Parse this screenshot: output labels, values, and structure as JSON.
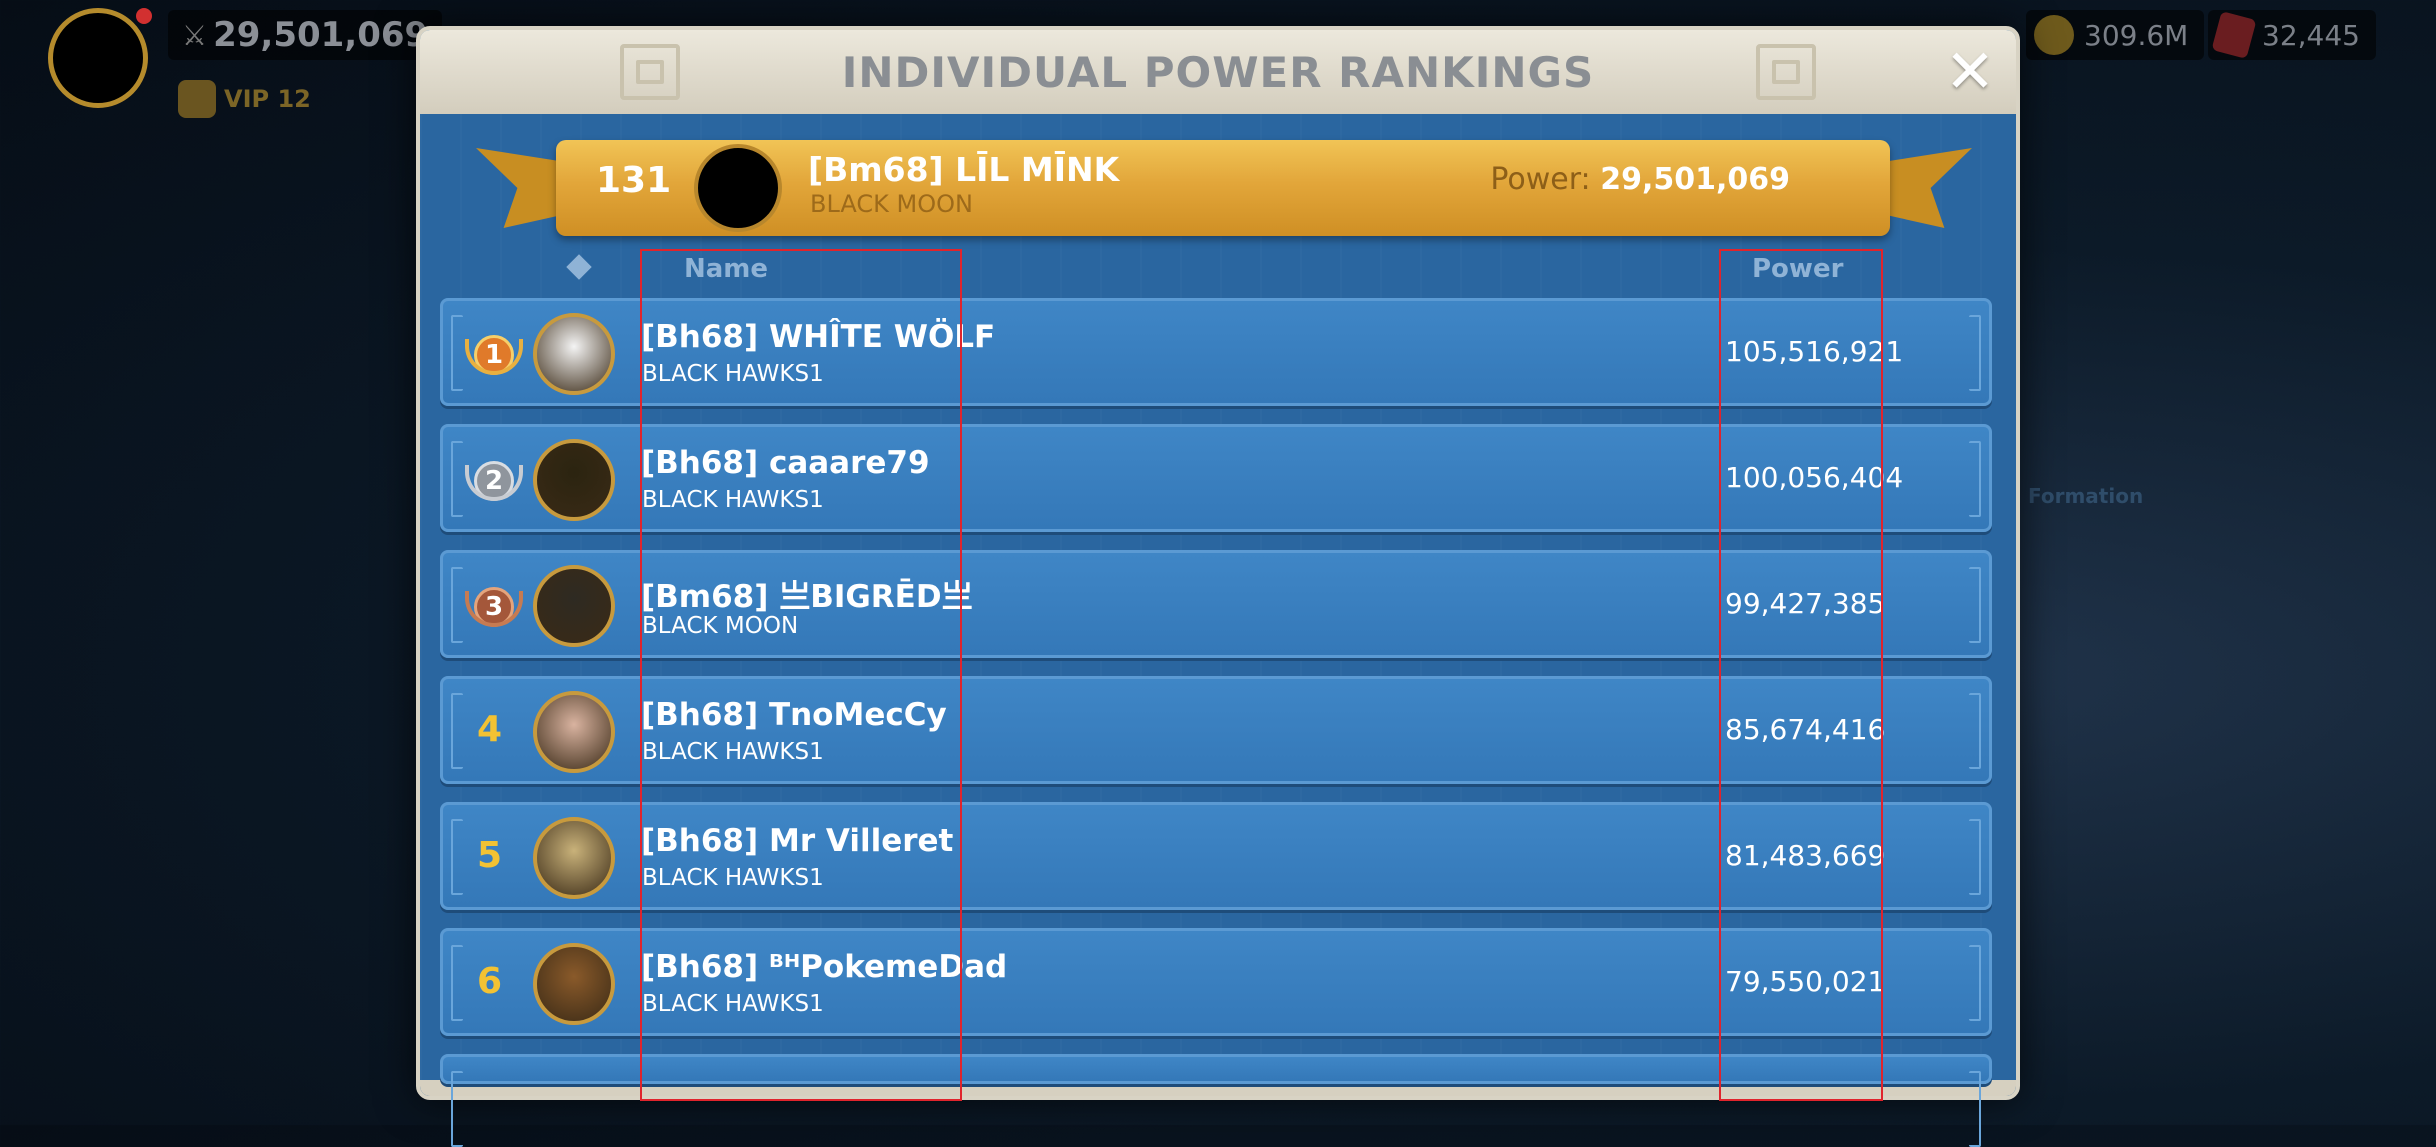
{
  "hud": {
    "power": "29,501,069",
    "vip": "VIP 12",
    "gold": "309.6M",
    "gems": "32,445",
    "formation": "Formation"
  },
  "dialog": {
    "title": "INDIVIDUAL POWER RANKINGS",
    "close_label": "✕"
  },
  "self": {
    "rank": "131",
    "name": "[Bm68] LĪL MĪNK",
    "alliance": "BLACK MOON",
    "power_label": "Power:",
    "power": "29,501,069"
  },
  "headers": {
    "rank_icon": "diamond-icon",
    "name": "Name",
    "power": "Power"
  },
  "rows": [
    {
      "rank": "1",
      "name": "[Bh68] WHÎTE WÖLF",
      "alliance": "BLACK HAWKS1",
      "power": "105,516,921",
      "avatar_color": "#f4f4f4"
    },
    {
      "rank": "2",
      "name": "[Bh68] caaare79",
      "alliance": "BLACK HAWKS1",
      "power": "100,056,404",
      "avatar_color": "#2b2410"
    },
    {
      "rank": "3",
      "name": "[Bm68] 亗BIGRĒD亗",
      "alliance": "BLACK MOON",
      "power": "99,427,385",
      "avatar_color": "#2e2a22"
    },
    {
      "rank": "4",
      "name": "[Bh68] TnoMecCy",
      "alliance": "BLACK HAWKS1",
      "power": "85,674,416",
      "avatar_color": "#d9b3a0"
    },
    {
      "rank": "5",
      "name": "[Bh68] Mr Villeret",
      "alliance": "BLACK HAWKS1",
      "power": "81,483,669",
      "avatar_color": "#c9b27a"
    },
    {
      "rank": "6",
      "name": "[Bh68] ᴮᴴPokemeDad",
      "alliance": "BLACK HAWKS1",
      "power": "79,550,021",
      "avatar_color": "#8a5a2a"
    }
  ],
  "colors": {
    "panel_blue": "#2f6fa9",
    "banner_gold": "#e2a63a",
    "rank_gold": "#f2c233",
    "highlight_red": "#e0242c"
  }
}
